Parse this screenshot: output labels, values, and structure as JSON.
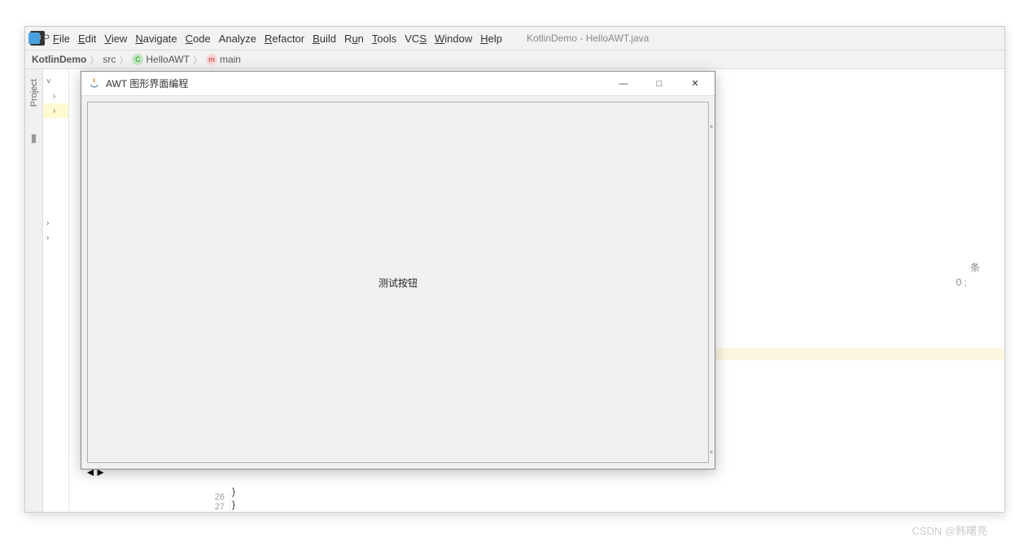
{
  "ide": {
    "window_title": "KotlinDemo - HelloAWT.java",
    "menu": {
      "file": "File",
      "edit": "Edit",
      "view": "View",
      "navigate": "Navigate",
      "code": "Code",
      "analyze": "Analyze",
      "refactor": "Refactor",
      "build": "Build",
      "run": "Run",
      "tools": "Tools",
      "vcs": "VCS",
      "window": "Window",
      "help": "Help"
    },
    "logo_text": "IJ"
  },
  "breadcrumbs": {
    "project": "KotlinDemo",
    "src": "src",
    "file_badge": "C",
    "file": "HelloAWT",
    "method_badge": "m",
    "method": "main"
  },
  "sidebar": {
    "tab_label": "Project",
    "project_label": "P"
  },
  "tree": {
    "chev_down": "˅",
    "chev_right": "›"
  },
  "editor": {
    "gutter": [
      "26",
      "27"
    ],
    "lines": [
      "        }",
      "}"
    ],
    "hint_line1": "条",
    "hint_line2": "0 ;"
  },
  "awt_window": {
    "title": "AWT 图形界面编程",
    "button_label": "测试按钮",
    "min_glyph": "—",
    "max_glyph": "□",
    "close_glyph": "✕",
    "scroll_up": "▴",
    "scroll_down": "▾",
    "scroll_left": "◂",
    "scroll_right": "▸"
  },
  "watermark": "CSDN @韩曙亮"
}
